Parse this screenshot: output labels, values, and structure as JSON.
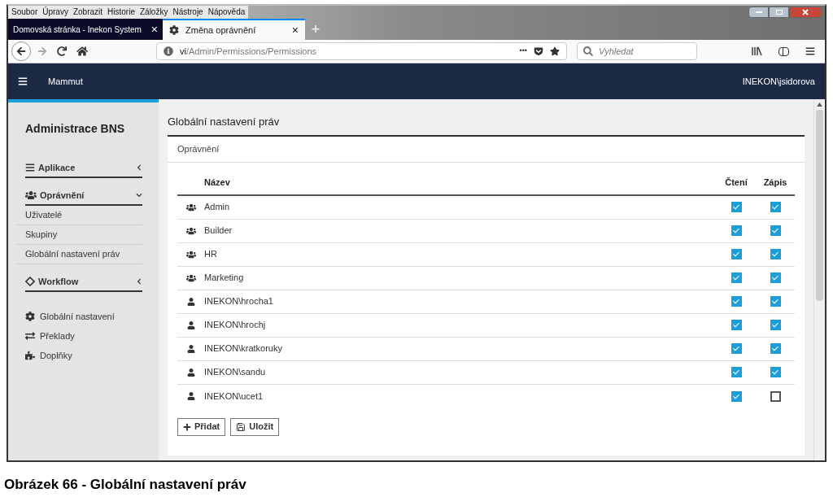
{
  "menu_bar": [
    "Soubor",
    "Úpravy",
    "Zobrazit",
    "Historie",
    "Záložky",
    "Nástroje",
    "Nápověda"
  ],
  "tabs": [
    {
      "label": "Domovská stránka - Inekon System",
      "selected": false
    },
    {
      "label": "Změna oprávnění",
      "selected": true
    }
  ],
  "tab_close": "×",
  "new_tab": "+",
  "address": {
    "host": "vi",
    "path": "/Admin/Permissions/Permissions"
  },
  "address_more": "•••",
  "search": {
    "placeholder": "Vyhledat"
  },
  "app_header": {
    "title": "Mammut",
    "user": "INEKON\\jsidorova"
  },
  "sidebar": {
    "title": "Administrace BNS",
    "sections": [
      {
        "label": "Aplikace",
        "expanded": false
      },
      {
        "label": "Oprávnění",
        "expanded": true,
        "children": [
          {
            "label": "Uživatelé"
          },
          {
            "label": "Skupiny"
          },
          {
            "label": "Globální nastavení práv"
          }
        ]
      },
      {
        "label": "Workflow",
        "expanded": false
      }
    ],
    "links": [
      {
        "label": "Globální nastavení"
      },
      {
        "label": "Překlady"
      },
      {
        "label": "Doplňky"
      }
    ]
  },
  "page_title": "Globální nastavení práv",
  "card_tab": "Oprávnění",
  "table": {
    "columns": [
      "Název",
      "Čtení",
      "Zápis"
    ],
    "rows": [
      {
        "kind": "group",
        "name": "Admin",
        "read": true,
        "write": true
      },
      {
        "kind": "group",
        "name": "Builder",
        "read": true,
        "write": true
      },
      {
        "kind": "group",
        "name": "HR",
        "read": true,
        "write": true
      },
      {
        "kind": "group",
        "name": "Marketing",
        "read": true,
        "write": true
      },
      {
        "kind": "user",
        "name": "INEKON\\hrocha1",
        "read": true,
        "write": true
      },
      {
        "kind": "user",
        "name": "INEKON\\hrochj",
        "read": true,
        "write": true
      },
      {
        "kind": "user",
        "name": "INEKON\\kratkoruky",
        "read": true,
        "write": true
      },
      {
        "kind": "user",
        "name": "INEKON\\sandu",
        "read": true,
        "write": true
      },
      {
        "kind": "user",
        "name": "INEKON\\ucet1",
        "read": true,
        "write": false
      }
    ]
  },
  "buttons": [
    {
      "kind": "add",
      "label": "Přidat"
    },
    {
      "kind": "save",
      "label": "Uložit"
    }
  ],
  "caption": "Obrázek 66 - Globální nastavení práv"
}
